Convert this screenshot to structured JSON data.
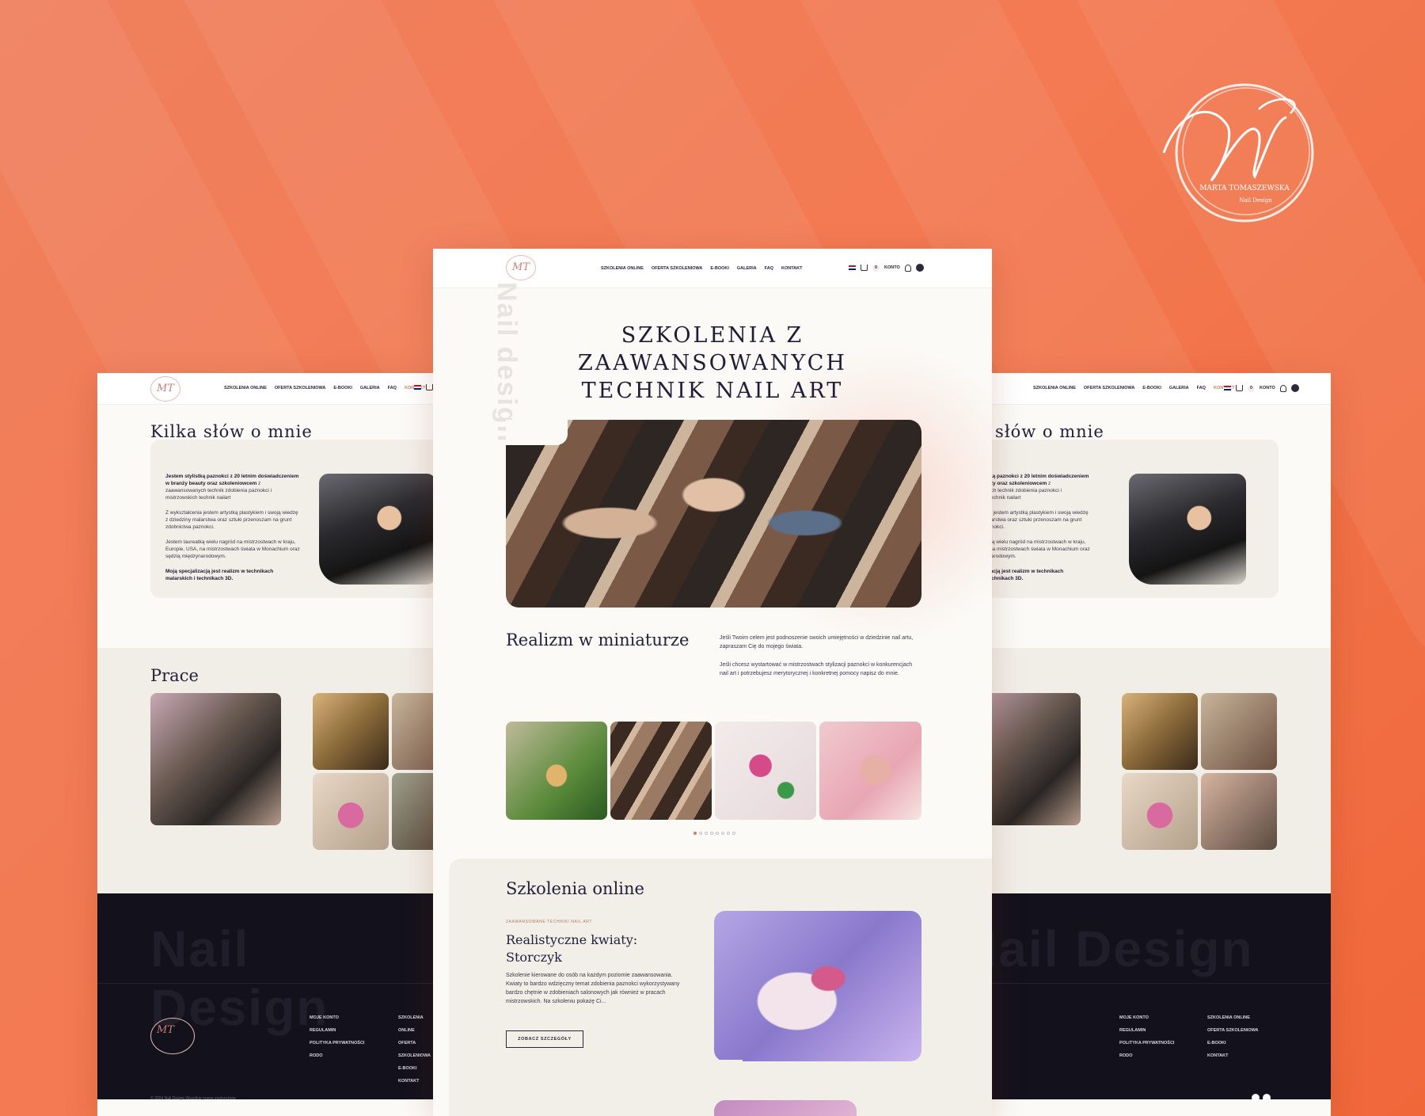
{
  "brand": {
    "name": "MARTA TOMASZEWSKA",
    "sub": "Nail Design",
    "accent": "#c97c66",
    "background": "#f37a52"
  },
  "nav": {
    "items": [
      "SZKOLENIA ONLINE",
      "OFERTA SZKOLENIOWA",
      "E-BOOKI",
      "GALERIA",
      "FAQ",
      "KONTAKT"
    ],
    "account": "KONTO",
    "cart_count": "0"
  },
  "hero": {
    "vertical_word": "Nail design",
    "title_line1": "SZKOLENIA Z",
    "title_line2": "ZAAWANSOWANYCH",
    "title_line3": "TECHNIK NAIL ART"
  },
  "realizm": {
    "title": "Realizm w miniaturze",
    "p1": "Jeśli Twoim celem jest podnoszenie swoich umiejętności w dziedzinie nail artu, zapraszam Cię do mojego świata.",
    "p2": "Jeśli chcesz wystartować w mistrzostwach stylizacji paznokci w konkurencjach nail art i potrzebujesz merytorycznej i konkretnej pomocy napisz do mnie."
  },
  "online": {
    "title": "Szkolenia online",
    "tag": "ZAAWANSOWANE TECHNIKI NAIL ART",
    "course_title": "Realistyczne kwiaty: Storczyk",
    "course_desc": "Szkolenie kierowane do osób na każdym poziomie zaawansowania. Kwiaty to bardzo wdzięczny temat zdobienia paznokci wykorzystywany bardzo chętnie w zdobieniach salonowych jak również w pracach mistrzowskich. Na szkoleniu pokażę Ci...",
    "button": "ZOBACZ SZCZEGÓŁY"
  },
  "about": {
    "title": "Kilka słów o mnie",
    "lead_bold1": "Jestem stylistką paznokci z 20 letnim doświadczeniem w branży beauty oraz szkoleniowcem",
    "lead_rest": " z zaawansowanych technik zdobienia paznokci i mistrzowskich technik nailart",
    "p2": "Z wykształcenia jestem artystką plastykiem i swoją wiedzę z dziedziny malarstwa oraz sztuki przenoszam na grunt zdobnictwa paznokci.",
    "p3": "Jestem laureatką wielu nagród na mistrzostwach w kraju, Europie, USA, na mistrzostwach świata w Monachium oraz sędzią międzynarodowym.",
    "p4": "Moją specjalizacją jest realizm w technikach malarskich i technikach 3D."
  },
  "works": {
    "title": "Prace"
  },
  "footer": {
    "big": "Nail Design",
    "col1": [
      "MOJE KONTO",
      "REGULAMIN",
      "POLITYKA PRYWATNOŚCI",
      "RODO"
    ],
    "col2": [
      "SZKOLENIA ONLINE",
      "OFERTA SZKOLENIOWA",
      "E-BOOKI",
      "KONTAKT"
    ],
    "copyright": "© 2024 Nail Design Wszelkie prawa zastrzeżone"
  }
}
